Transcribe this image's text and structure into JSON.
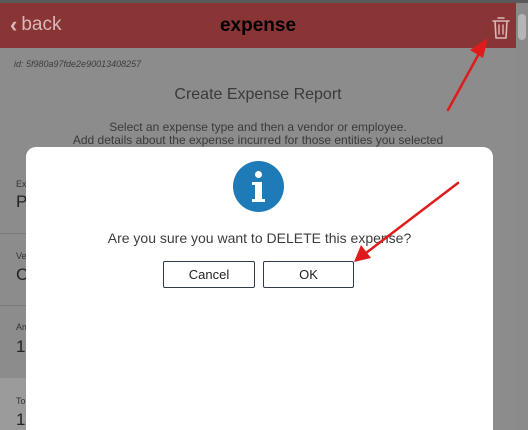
{
  "header": {
    "back_label": "back",
    "title": "expense",
    "back_icon": "chevron-left-icon",
    "delete_icon": "trash-icon",
    "background_color": "#8a3535"
  },
  "page": {
    "record_id": "id: 5f980a97fde2e90013408257",
    "heading": "Create Expense Report",
    "description_line1": "Select an expense type and then a vendor or employee.",
    "description_line2": "Add details about the expense incurred for those entities you selected",
    "fields": [
      {
        "label": "Ex",
        "value": "P"
      },
      {
        "label": "Ve",
        "value": "C"
      },
      {
        "label": "Am",
        "value": "1"
      },
      {
        "label": "To",
        "value": "1"
      }
    ]
  },
  "dialog": {
    "icon": "info-icon",
    "icon_color": "#1f7ab8",
    "message": "Are you sure you want to DELETE this expense?",
    "cancel_label": "Cancel",
    "ok_label": "OK"
  },
  "annotation_color": "#e01b1b"
}
